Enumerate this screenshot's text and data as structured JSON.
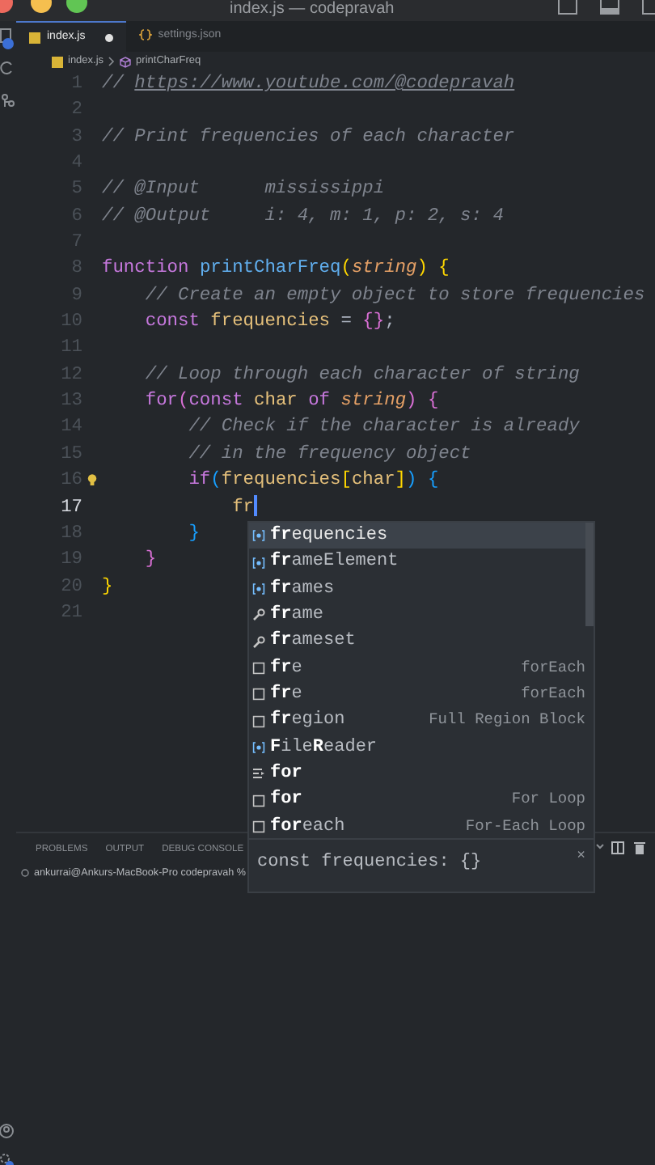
{
  "window": {
    "title": "index.js — codepravah"
  },
  "tabs": [
    {
      "label": "index.js",
      "kind": "js",
      "selected": true,
      "modified": true
    },
    {
      "label": "settings.json",
      "kind": "json",
      "selected": false,
      "modified": false
    }
  ],
  "breadcrumb": [
    {
      "label": "index.js",
      "kind": "file"
    },
    {
      "label": "printCharFreq",
      "kind": "symbol"
    }
  ],
  "editor": {
    "lines": [
      {
        "number": "1",
        "current": false,
        "lightbulb": false,
        "tokens": [
          {
            "text": "// ",
            "kind": "comment"
          },
          {
            "text": "https://www.youtube.com/@codepravah",
            "kind": "link"
          }
        ]
      },
      {
        "number": "2",
        "current": false,
        "lightbulb": false
      },
      {
        "number": "3",
        "current": false,
        "lightbulb": false,
        "tokens": [
          {
            "text": "// Print frequencies of each character",
            "kind": "comment"
          }
        ]
      },
      {
        "number": "4",
        "current": false,
        "lightbulb": false
      },
      {
        "number": "5",
        "current": false,
        "lightbulb": false,
        "tokens": [
          {
            "text": "// @Input      mississippi",
            "kind": "comment"
          }
        ]
      },
      {
        "number": "6",
        "current": false,
        "lightbulb": false,
        "tokens": [
          {
            "text": "// @Output     i: 4, m: 1, p: 2, s: 4",
            "kind": "comment"
          }
        ]
      },
      {
        "number": "7",
        "current": false,
        "lightbulb": false
      },
      {
        "number": "8",
        "current": false,
        "lightbulb": false,
        "tokens": [
          {
            "text": "function ",
            "kind": "keyword"
          },
          {
            "text": "printCharFreq",
            "kind": "function"
          },
          {
            "text": "(",
            "kind": "bracket1"
          },
          {
            "text": "string",
            "kind": "param"
          },
          {
            "text": ") ",
            "kind": "bracket1"
          },
          {
            "text": "{",
            "kind": "bracket1"
          }
        ]
      },
      {
        "number": "9",
        "current": false,
        "lightbulb": false,
        "tokens": [
          {
            "text": "    // Create an empty object to store frequencies",
            "kind": "comment"
          }
        ]
      },
      {
        "number": "10",
        "current": false,
        "lightbulb": false,
        "tokens": [
          {
            "text": "    const ",
            "kind": "keyword"
          },
          {
            "text": "frequencies",
            "kind": "variable"
          },
          {
            "text": " = ",
            "kind": "plain"
          },
          {
            "text": "{}",
            "kind": "bracket2"
          },
          {
            "text": ";",
            "kind": "plain"
          }
        ]
      },
      {
        "number": "11",
        "current": false,
        "lightbulb": false
      },
      {
        "number": "12",
        "current": false,
        "lightbulb": false,
        "tokens": [
          {
            "text": "    // Loop through each character of string",
            "kind": "comment"
          }
        ]
      },
      {
        "number": "13",
        "current": false,
        "lightbulb": false,
        "tokens": [
          {
            "text": "    for",
            "kind": "keyword"
          },
          {
            "text": "(",
            "kind": "bracket2"
          },
          {
            "text": "const ",
            "kind": "keyword"
          },
          {
            "text": "char ",
            "kind": "variable"
          },
          {
            "text": "of ",
            "kind": "keyword"
          },
          {
            "text": "string",
            "kind": "param"
          },
          {
            "text": ") ",
            "kind": "bracket2"
          },
          {
            "text": "{",
            "kind": "bracket2"
          }
        ]
      },
      {
        "number": "14",
        "current": false,
        "lightbulb": false,
        "tokens": [
          {
            "text": "        // Check if the character is already",
            "kind": "comment"
          }
        ]
      },
      {
        "number": "15",
        "current": false,
        "lightbulb": false,
        "tokens": [
          {
            "text": "        // in the frequency object",
            "kind": "comment"
          }
        ]
      },
      {
        "number": "16",
        "current": false,
        "lightbulb": true,
        "tokens": [
          {
            "text": "        if",
            "kind": "keyword"
          },
          {
            "text": "(",
            "kind": "bracket3"
          },
          {
            "text": "frequencies",
            "kind": "variable"
          },
          {
            "text": "[",
            "kind": "bracket1"
          },
          {
            "text": "char",
            "kind": "variable"
          },
          {
            "text": "]",
            "kind": "bracket1"
          },
          {
            "text": ") ",
            "kind": "bracket3"
          },
          {
            "text": "{",
            "kind": "bracket3"
          }
        ]
      },
      {
        "number": "17",
        "current": true,
        "lightbulb": false,
        "tokens": [
          {
            "text": "            fr",
            "kind": "variable"
          }
        ]
      },
      {
        "number": "18",
        "current": false,
        "lightbulb": false,
        "tokens": [
          {
            "text": "        }",
            "kind": "bracket3"
          }
        ]
      },
      {
        "number": "19",
        "current": false,
        "lightbulb": false,
        "tokens": [
          {
            "text": "    }",
            "kind": "bracket2"
          }
        ]
      },
      {
        "number": "20",
        "current": false,
        "lightbulb": false,
        "tokens": [
          {
            "text": "}",
            "kind": "bracket1"
          }
        ]
      },
      {
        "number": "21",
        "current": false,
        "lightbulb": false
      }
    ]
  },
  "suggestions": {
    "items": [
      {
        "kind": "variable",
        "label": "**fr**equencies",
        "selected": true
      },
      {
        "kind": "variable",
        "label": "**fr**ameElement",
        "selected": false
      },
      {
        "kind": "variable",
        "label": "**fr**ames",
        "selected": false
      },
      {
        "kind": "property",
        "label": "**fr**ame",
        "selected": false
      },
      {
        "kind": "property",
        "label": "**fr**ameset",
        "selected": false
      },
      {
        "kind": "snippet",
        "label": "**fr**e",
        "detail": "forEach",
        "selected": false
      },
      {
        "kind": "snippet",
        "label": "**fr**e",
        "detail": "forEach",
        "selected": false
      },
      {
        "kind": "snippet",
        "label": "**fr**egion",
        "detail": "Full Region Block",
        "selected": false
      },
      {
        "kind": "variable",
        "label": "**F**ile**R**eader",
        "selected": false
      },
      {
        "kind": "keyword",
        "label": "**for**",
        "selected": false
      },
      {
        "kind": "snippet",
        "label": "**for**",
        "detail": "For Loop",
        "selected": false
      },
      {
        "kind": "snippet",
        "label": "**for**each",
        "detail": "For-Each Loop",
        "selected": false
      }
    ],
    "details": "const frequencies: {}",
    "close": "×"
  },
  "panel": {
    "tabs": [
      {
        "label": "PROBLEMS",
        "selected": false
      },
      {
        "label": "OUTPUT",
        "selected": false
      },
      {
        "label": "DEBUG CONSOLE",
        "selected": false
      }
    ],
    "terminal": "ankurrai@Ankurs-MacBook-Pro codepravah % "
  }
}
